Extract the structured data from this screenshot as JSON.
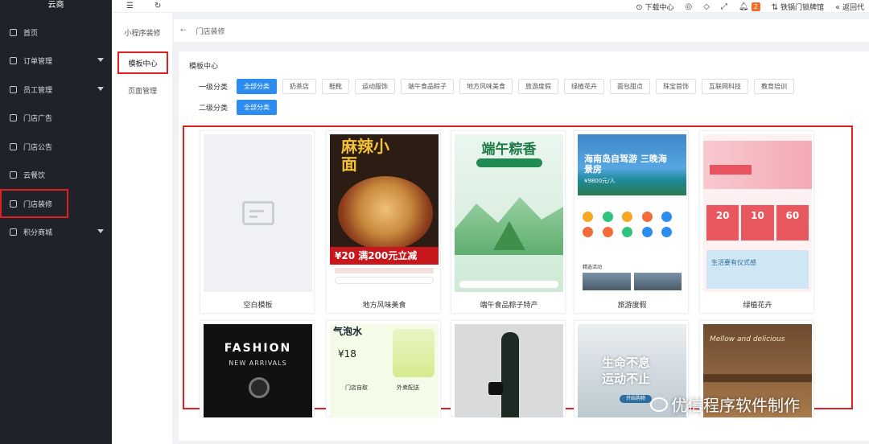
{
  "sidebar": {
    "brand": "云商",
    "items": [
      {
        "label": "首页",
        "expandable": false,
        "active": false
      },
      {
        "label": "订单管理",
        "expandable": true,
        "active": false
      },
      {
        "label": "员工管理",
        "expandable": true,
        "active": false
      },
      {
        "label": "门店广告",
        "expandable": false,
        "active": false
      },
      {
        "label": "门店公告",
        "expandable": false,
        "active": false
      },
      {
        "label": "云餐饮",
        "expandable": false,
        "active": false
      },
      {
        "label": "门店装修",
        "expandable": false,
        "active": true
      },
      {
        "label": "积分商城",
        "expandable": true,
        "active": false
      }
    ]
  },
  "subnav": {
    "items": [
      {
        "label": "小程序装修",
        "active": false
      },
      {
        "label": "模板中心",
        "active": true
      },
      {
        "label": "页面管理",
        "active": false
      }
    ]
  },
  "topbar": {
    "download_label": "下载中心",
    "notification_count": "2",
    "store_name": "铁锅门锁牌馆",
    "back_label": "返回代"
  },
  "breadcrumb": {
    "label": "门店装修"
  },
  "main": {
    "title": "模板中心",
    "level1_label": "一级分类",
    "level2_label": "二级分类",
    "level1_categories": [
      "全部分类",
      "奶茶店",
      "鞋靴",
      "运动服饰",
      "端午食品粽子",
      "地方风味美食",
      "旅游度假",
      "绿植花卉",
      "面包甜点",
      "珠宝首饰",
      "互联网科技",
      "教育培训"
    ],
    "level1_active": "全部分类",
    "level2_categories": [
      "全部分类"
    ]
  },
  "templates": [
    {
      "caption": "空白模板",
      "kind": "blank"
    },
    {
      "caption": "地方风味美食",
      "kind": "noodle",
      "title_text": "麻辣小面",
      "promo_text": "¥20 满200元立减"
    },
    {
      "caption": "端午食品粽子特产",
      "kind": "zongzi",
      "title_text": "端午粽香"
    },
    {
      "caption": "旅游度假",
      "kind": "travel",
      "title_text": "海南岛自驾游 三晚海景房",
      "price_text": "¥9800元/人",
      "section_text": "精选活动"
    },
    {
      "caption": "绿植花卉",
      "kind": "flower",
      "coupons": [
        "20",
        "10",
        "60"
      ],
      "life_text": "生活要有仪式感"
    },
    {
      "caption": "",
      "kind": "fashion",
      "title_text": "FASHION",
      "sub_text": "NEW ARRIVALS"
    },
    {
      "caption": "",
      "kind": "drink",
      "title_text": "气泡水",
      "price_text": "¥18",
      "options": [
        "门店自取",
        "外卖配送"
      ]
    },
    {
      "caption": "",
      "kind": "model"
    },
    {
      "caption": "",
      "kind": "sport",
      "title_text": "生命不息 运动不止",
      "button_text": "开始购物"
    },
    {
      "caption": "",
      "kind": "bakery",
      "title_text": "Mellow and delicious"
    }
  ],
  "watermark": "优信程序软件制作"
}
